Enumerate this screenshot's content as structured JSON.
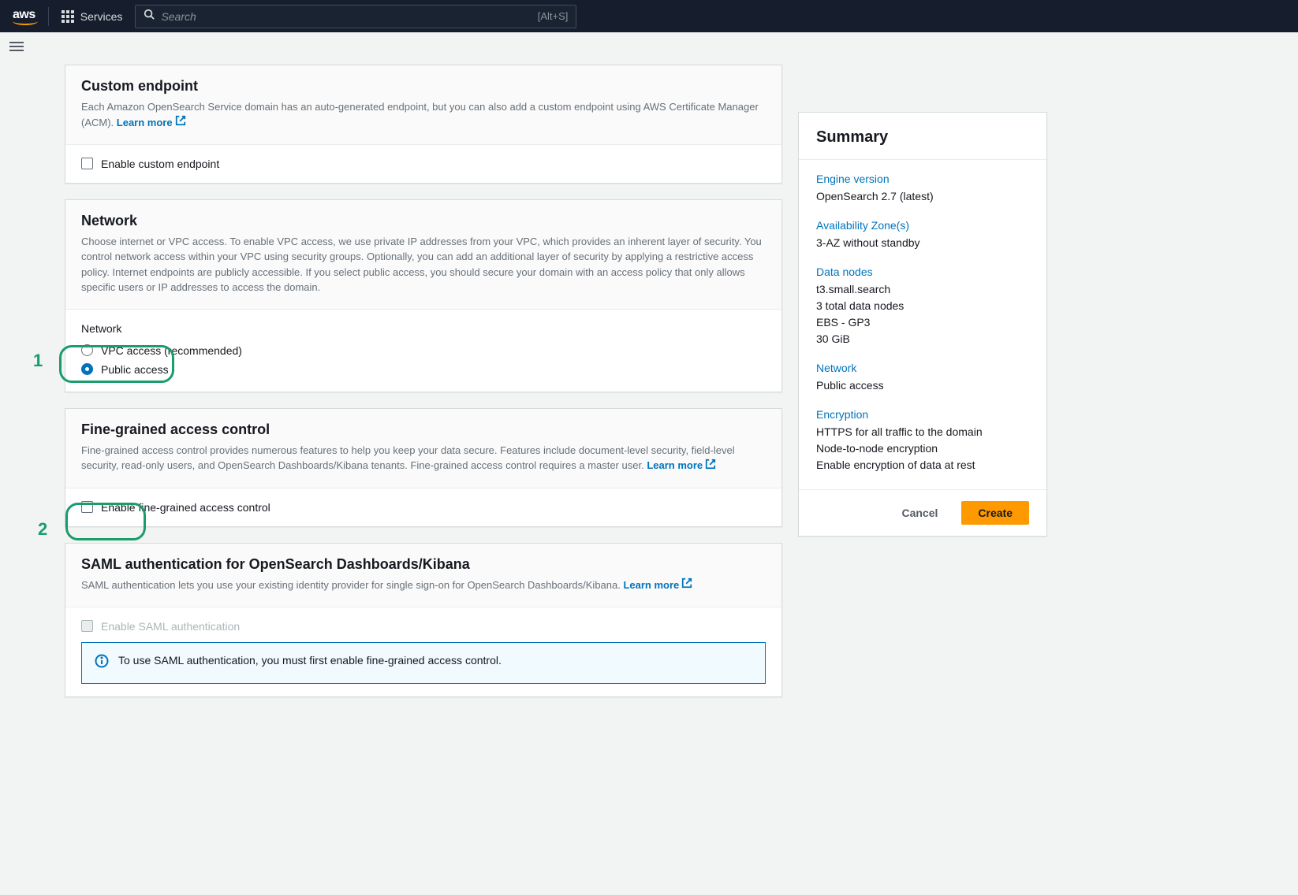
{
  "nav": {
    "services_label": "Services",
    "search_placeholder": "Search",
    "search_shortcut": "[Alt+S]"
  },
  "custom_endpoint": {
    "title": "Custom endpoint",
    "desc": "Each Amazon OpenSearch Service domain has an auto-generated endpoint, but you can also add a custom endpoint using AWS Certificate Manager (ACM). ",
    "learn_more": "Learn more",
    "checkbox_label": "Enable custom endpoint"
  },
  "network": {
    "title": "Network",
    "desc": "Choose internet or VPC access. To enable VPC access, we use private IP addresses from your VPC, which provides an inherent layer of security. You control network access within your VPC using security groups. Optionally, you can add an additional layer of security by applying a restrictive access policy. Internet endpoints are publicly accessible. If you select public access, you should secure your domain with an access policy that only allows specific users or IP addresses to access the domain.",
    "field_label": "Network",
    "option_vpc": "VPC access (recommended)",
    "option_public": "Public access"
  },
  "fgac": {
    "title": "Fine-grained access control",
    "desc": "Fine-grained access control provides numerous features to help you keep your data secure. Features include document-level security, field-level security, read-only users, and OpenSearch Dashboards/Kibana tenants. Fine-grained access control requires a master user. ",
    "learn_more": "Learn more",
    "checkbox_label": "Enable fine-grained access control"
  },
  "saml": {
    "title": "SAML authentication for OpenSearch Dashboards/Kibana",
    "desc": "SAML authentication lets you use your existing identity provider for single sign-on for OpenSearch Dashboards/Kibana. ",
    "learn_more": "Learn more",
    "checkbox_label": "Enable SAML authentication",
    "info_text": "To use SAML authentication, you must first enable fine-grained access control."
  },
  "summary": {
    "title": "Summary",
    "engine_label": "Engine version",
    "engine_value": "OpenSearch 2.7 (latest)",
    "az_label": "Availability Zone(s)",
    "az_value": "3-AZ without standby",
    "data_nodes_label": "Data nodes",
    "data_nodes_values": [
      "t3.small.search",
      "3 total data nodes",
      "EBS - GP3",
      "30 GiB"
    ],
    "network_label": "Network",
    "network_value": "Public access",
    "encryption_label": "Encryption",
    "encryption_values": [
      "HTTPS for all traffic to the domain",
      "Node-to-node encryption",
      "Enable encryption of data at rest"
    ],
    "cancel": "Cancel",
    "create": "Create"
  },
  "annotations": {
    "one": "1",
    "two": "2"
  }
}
